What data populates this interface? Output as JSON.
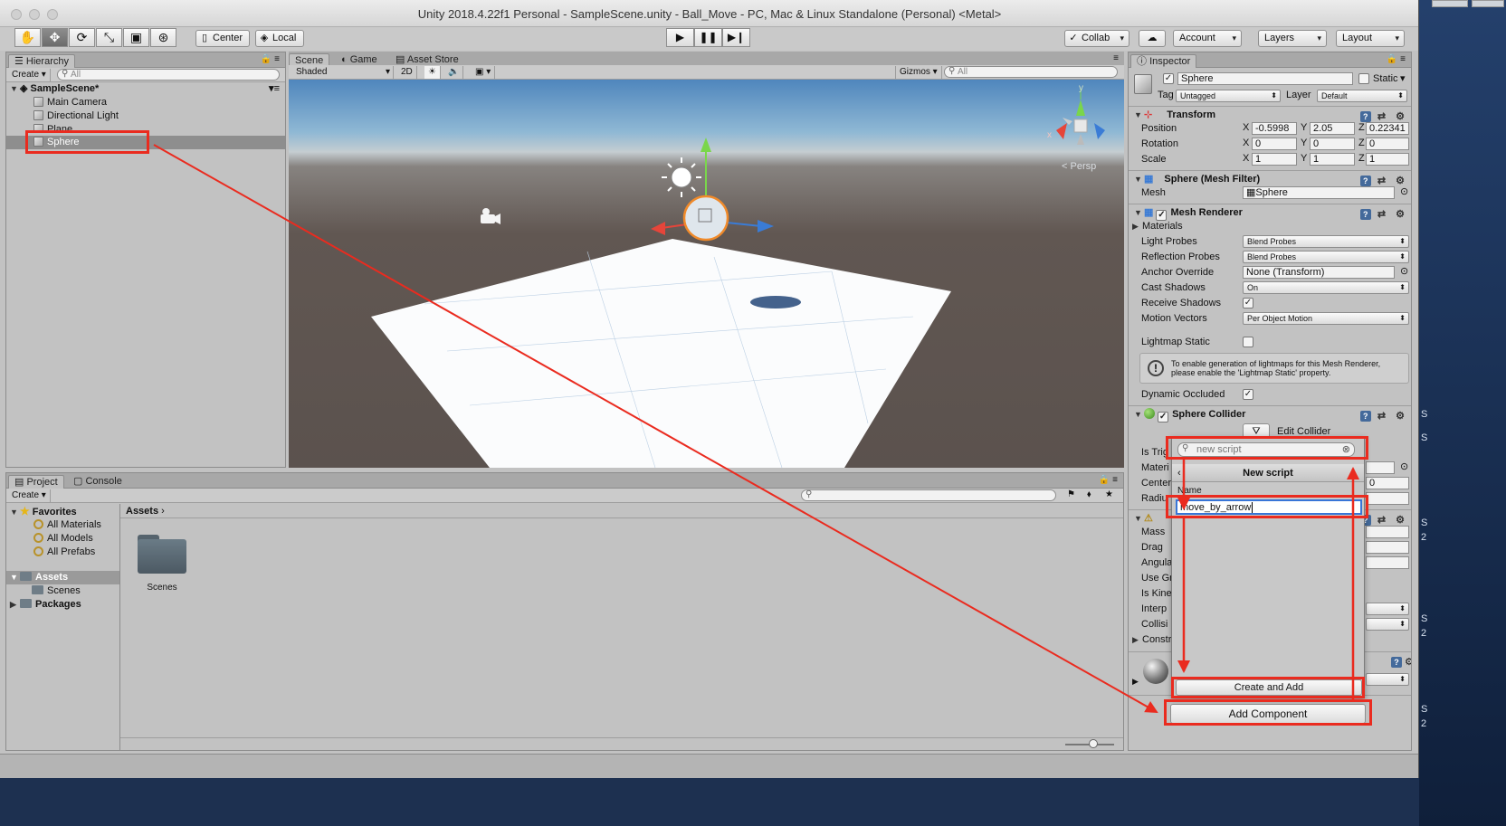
{
  "window": {
    "title": "Unity 2018.4.22f1 Personal - SampleScene.unity - Ball_Move - PC, Mac & Linux Standalone (Personal) <Metal>"
  },
  "toolbar": {
    "center": "Center",
    "local": "Local",
    "collab": "Collab",
    "account": "Account",
    "layers": "Layers",
    "layout": "Layout"
  },
  "hierarchy": {
    "tab": "Hierarchy",
    "create": "Create",
    "search_placeholder": "All",
    "scene": "SampleScene*",
    "items": [
      "Main Camera",
      "Directional Light",
      "Plane",
      "Sphere"
    ]
  },
  "scene_view": {
    "tabs": [
      "Scene",
      "Game",
      "Asset Store"
    ],
    "shading": "Shaded",
    "mode_2d": "2D",
    "gizmos": "Gizmos",
    "search_placeholder": "All",
    "persp": "Persp",
    "axis_y": "y",
    "axis_x": "x"
  },
  "project": {
    "tabs": [
      "Project",
      "Console"
    ],
    "create": "Create",
    "favorites": "Favorites",
    "favorite_items": [
      "All Materials",
      "All Models",
      "All Prefabs"
    ],
    "assets": "Assets",
    "assets_children": [
      "Scenes"
    ],
    "packages": "Packages",
    "breadcrumb": "Assets",
    "grid_items": [
      "Scenes"
    ]
  },
  "inspector": {
    "tab": "Inspector",
    "object_name": "Sphere",
    "static_label": "Static",
    "tag_label": "Tag",
    "tag_value": "Untagged",
    "layer_label": "Layer",
    "layer_value": "Default",
    "transform": {
      "title": "Transform",
      "rows": [
        {
          "label": "Position",
          "x": "-0.5998",
          "y": "2.05",
          "z": "0.22341"
        },
        {
          "label": "Rotation",
          "x": "0",
          "y": "0",
          "z": "0"
        },
        {
          "label": "Scale",
          "x": "1",
          "y": "1",
          "z": "1"
        }
      ],
      "axis_x": "X",
      "axis_y": "Y",
      "axis_z": "Z"
    },
    "mesh_filter": {
      "title": "Sphere (Mesh Filter)",
      "mesh_label": "Mesh",
      "mesh_value": "Sphere"
    },
    "mesh_renderer": {
      "title": "Mesh Renderer",
      "materials": "Materials",
      "light_probes_label": "Light Probes",
      "light_probes": "Blend Probes",
      "reflection_probes_label": "Reflection Probes",
      "reflection_probes": "Blend Probes",
      "anchor_override_label": "Anchor Override",
      "anchor_override": "None (Transform)",
      "cast_shadows_label": "Cast Shadows",
      "cast_shadows": "On",
      "receive_shadows_label": "Receive Shadows",
      "motion_vectors_label": "Motion Vectors",
      "motion_vectors": "Per Object Motion",
      "lightmap_static_label": "Lightmap Static",
      "info_line1": "To enable generation of lightmaps for this Mesh Renderer,",
      "info_line2": "please enable the 'Lightmap Static' property.",
      "dynamic_occluded_label": "Dynamic Occluded"
    },
    "sphere_collider": {
      "title": "Sphere Collider",
      "edit_collider": "Edit Collider",
      "partial_labels": [
        "Is Trig",
        "Materi",
        "Center",
        "Radiu"
      ],
      "center_z": "0"
    },
    "rigidbody": {
      "partial_labels": [
        "Mass",
        "Drag",
        "Angula",
        "Use Gr",
        "Is Kine",
        "Interp",
        "Collisi",
        "Constr"
      ]
    },
    "add_component": "Add Component"
  },
  "popup": {
    "search_value": "new script",
    "header": "New script",
    "name_label": "Name",
    "name_value": "move_by_arrow",
    "create_button": "Create and Add"
  },
  "desktop_labels": [
    "S",
    "S",
    "2",
    "S",
    "S",
    "2",
    "S",
    "2"
  ],
  "colors": {
    "annotation_red": "#ea2b1f",
    "selection_blue": "#3875d7"
  }
}
